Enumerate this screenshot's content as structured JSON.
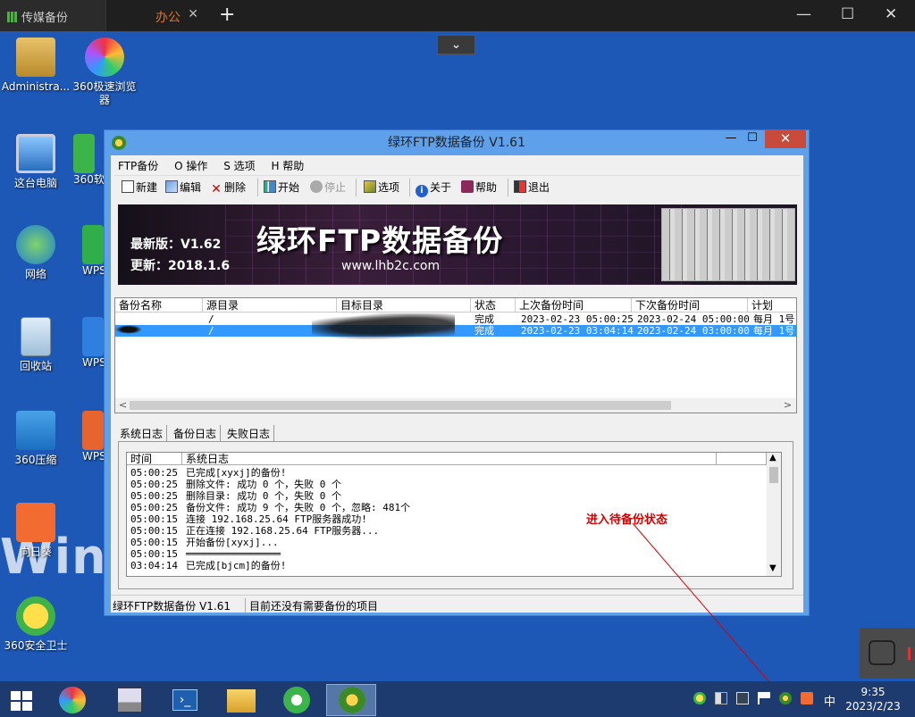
{
  "browser": {
    "tab1_label": "传媒备份",
    "tab2_label": "办公",
    "tab_close": "✕",
    "new_tab": "+",
    "minimize": "—",
    "maximize": "☐",
    "close": "✕",
    "dropdown": "⌄"
  },
  "desktop": {
    "icons": [
      {
        "label": "Administra...",
        "icon": "user-folder-icon"
      },
      {
        "label": "360极速浏览器",
        "icon": "360-browser-icon"
      },
      {
        "label": "这台电脑",
        "icon": "computer-icon"
      },
      {
        "label": "360软",
        "icon": "360-software-icon"
      },
      {
        "label": "网络",
        "icon": "network-icon"
      },
      {
        "label": "WPS",
        "icon": "wps-icon"
      },
      {
        "label": "回收站",
        "icon": "recycle-bin-icon"
      },
      {
        "label": "WPS",
        "icon": "wps-icon"
      },
      {
        "label": "360压缩",
        "icon": "360-zip-icon"
      },
      {
        "label": "WPS",
        "icon": "wps-icon"
      },
      {
        "label": "向日葵",
        "icon": "sunflower-icon"
      },
      {
        "label": "360安全卫士",
        "icon": "360-security-icon"
      }
    ],
    "watermark": "Win"
  },
  "app": {
    "title": "绿环FTP数据备份 V1.61",
    "minimize": "—",
    "maximize": "☐",
    "close": "✕",
    "menu": [
      "FTP备份",
      "O 操作",
      "S 选项",
      "H 帮助"
    ],
    "toolbar": [
      {
        "label": "新建",
        "icon": "new-icon"
      },
      {
        "label": "编辑",
        "icon": "edit-icon"
      },
      {
        "label": "删除",
        "icon": "delete-icon"
      },
      {
        "label": "开始",
        "icon": "start-icon"
      },
      {
        "label": "停止",
        "icon": "stop-icon"
      },
      {
        "label": "选项",
        "icon": "options-icon"
      },
      {
        "label": "关于",
        "icon": "about-icon"
      },
      {
        "label": "帮助",
        "icon": "help-icon"
      },
      {
        "label": "退出",
        "icon": "exit-icon"
      }
    ],
    "banner": {
      "version": "最新版：V1.62",
      "update": "更新：2018.1.6",
      "title": "绿环FTP数据备份",
      "url": "www.lhb2c.com"
    },
    "columns": [
      "备份名称",
      "源目录",
      "目标目录",
      "状态",
      "上次备份时间",
      "下次备份时间",
      "计划"
    ],
    "rows": [
      {
        "name": "",
        "src": "/",
        "dst": "",
        "status": "完成",
        "last": "2023-02-23 05:00:25",
        "next": "2023-02-24 05:00:00",
        "plan": "每月 1号"
      },
      {
        "name": "",
        "src": "/",
        "dst": "",
        "status": "完成",
        "last": "2023-02-23 03:04:14",
        "next": "2023-02-24 03:00:00",
        "plan": "每月 1号"
      }
    ],
    "tabs": [
      "系统日志",
      "备份日志",
      "失败日志"
    ],
    "log_columns": [
      "时间",
      "系统日志"
    ],
    "log": [
      {
        "time": "05:00:25",
        "msg": "已完成[xyxj]的备份!"
      },
      {
        "time": "05:00:25",
        "msg": "删除文件: 成功 0 个，失败 0 个"
      },
      {
        "time": "05:00:25",
        "msg": "删除目录: 成功 0 个，失败 0 个"
      },
      {
        "time": "05:00:25",
        "msg": "备份文件: 成功 9 个，失败 0 个，忽略: 481个"
      },
      {
        "time": "05:00:15",
        "msg": "连接 192.168.25.64 FTP服务器成功!"
      },
      {
        "time": "05:00:15",
        "msg": "正在连接 192.168.25.64 FTP服务器..."
      },
      {
        "time": "05:00:15",
        "msg": "开始备份[xyxj]..."
      },
      {
        "time": "05:00:15",
        "msg": "════════════════"
      },
      {
        "time": "03:04:14",
        "msg": "已完成[bjcm]的备份!"
      }
    ],
    "status_left": "绿环FTP数据备份 V1.61",
    "status_right": "目前还没有需要备份的项目"
  },
  "annotation": "进入待备份状态",
  "taskbar": {
    "apps": [
      "windows-start-icon",
      "360-app-icon",
      "server-manager-icon",
      "powershell-icon",
      "file-explorer-icon",
      "360-browser-icon",
      "lhb2c-ftp-icon"
    ],
    "ime": "中",
    "time": "9:35",
    "date": "2023/2/23"
  },
  "colors": {
    "desktop": "#1d58b6",
    "window_frame": "#5ea0ea",
    "selection": "#3399ff",
    "annotation": "#d40000"
  }
}
